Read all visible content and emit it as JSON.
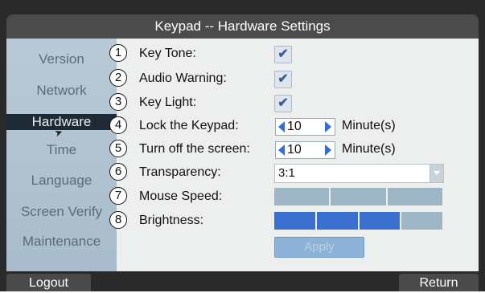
{
  "window": {
    "title": "Keypad -- Hardware Settings"
  },
  "sidebar": {
    "items": [
      {
        "label": "Version"
      },
      {
        "label": "Network"
      },
      {
        "label": "Hardware"
      },
      {
        "label": "Time"
      },
      {
        "label": "Language"
      },
      {
        "label": "Screen Verify"
      },
      {
        "label": "Maintenance"
      }
    ],
    "active": "Hardware"
  },
  "settings": {
    "key_tone": {
      "num": "1",
      "label": "Key Tone:",
      "checked": "✔"
    },
    "audio_warning": {
      "num": "2",
      "label": "Audio Warning:",
      "checked": "✔"
    },
    "key_light": {
      "num": "3",
      "label": "Key Light:",
      "checked": "✔"
    },
    "lock_keypad": {
      "num": "4",
      "label": "Lock the Keypad:",
      "value": "10",
      "unit": "Minute(s)"
    },
    "turn_off_screen": {
      "num": "5",
      "label": "Turn off the screen:",
      "value": "10",
      "unit": "Minute(s)"
    },
    "transparency": {
      "num": "6",
      "label": "Transparency:",
      "value": "3:1"
    },
    "mouse_speed": {
      "num": "7",
      "label": "Mouse Speed:",
      "level": 0
    },
    "brightness": {
      "num": "8",
      "label": "Brightness:",
      "level": 3,
      "max": 4
    }
  },
  "buttons": {
    "apply": "Apply",
    "logout": "Logout",
    "return": "Return"
  },
  "colors": {
    "active_bg": "#1e2a36",
    "accent": "#3b6fd0"
  }
}
